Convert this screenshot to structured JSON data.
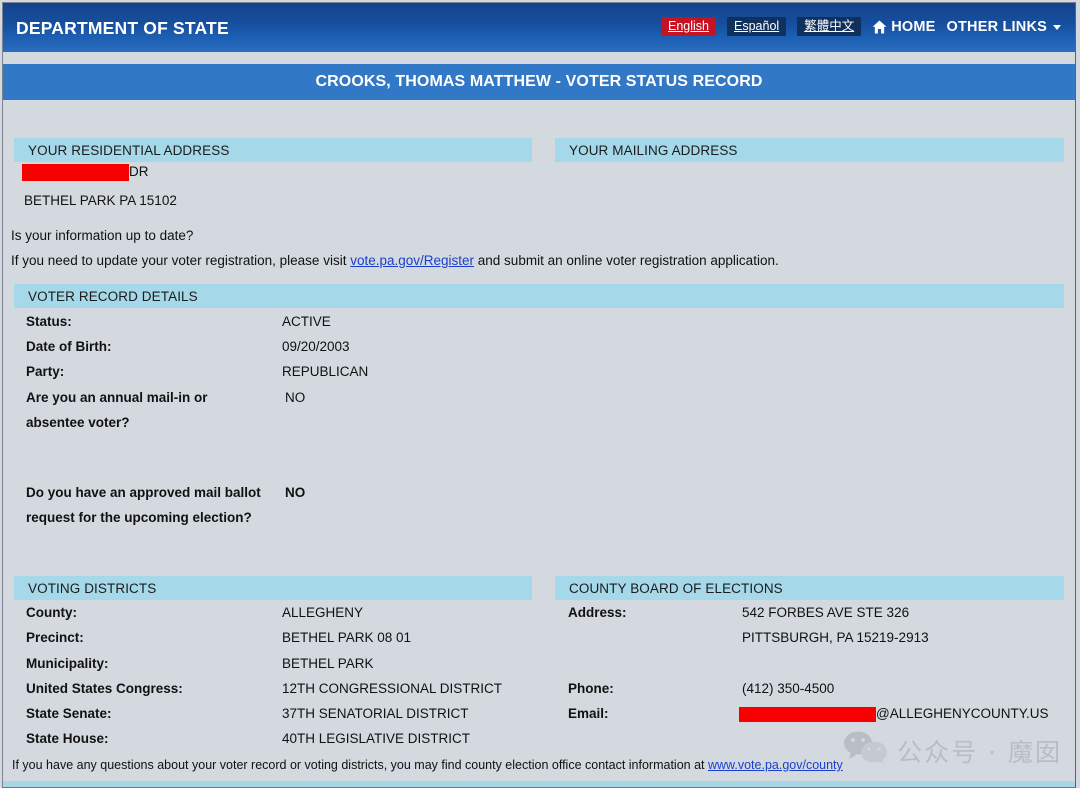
{
  "header": {
    "department_title": "DEPARTMENT OF STATE",
    "languages": [
      {
        "label": "English",
        "active": true
      },
      {
        "label": "Español",
        "active": false
      },
      {
        "label": "繁體中文",
        "active": false
      }
    ],
    "home_label": "HOME",
    "home_icon": "home-icon",
    "other_links_label": "OTHER LINKS",
    "other_links_icon": "chevron-down-icon",
    "colors": {
      "header_blue": "#17509f",
      "title_bar_blue": "#3178c6",
      "section_bar_blue": "#a5d8e8",
      "body_gray": "#d4d9e0",
      "active_lang_red": "#c41322",
      "link_blue": "#1a3fcc",
      "redaction_red": "#f60000"
    }
  },
  "record_title": "CROOKS, THOMAS MATTHEW - VOTER STATUS RECORD",
  "residential_address": {
    "section_title": "YOUR RESIDENTIAL ADDRESS",
    "line1_redacted": true,
    "line1_suffix": "DR",
    "line2": "BETHEL PARK PA 15102"
  },
  "mailing_address": {
    "section_title": "YOUR MAILING ADDRESS"
  },
  "update_prompt": {
    "question": "Is your information up to date?",
    "sentence_before_link": "If you need to update your voter registration, please visit ",
    "link_text": "vote.pa.gov/Register",
    "sentence_after_link": " and submit an online voter registration application."
  },
  "voter_record_details": {
    "section_title": "VOTER RECORD DETAILS",
    "fields": [
      {
        "label": "Status:",
        "value": "ACTIVE"
      },
      {
        "label": "Date of Birth:",
        "value": "09/20/2003"
      },
      {
        "label": "Party:",
        "value": "REPUBLICAN"
      },
      {
        "label_line1": "Are you an annual mail-in or",
        "label_line2": "absentee voter?",
        "value": "NO"
      },
      {
        "label_line1": "Do you have an approved mail ballot",
        "label_line2": "request for the upcoming election?",
        "value": "NO"
      }
    ]
  },
  "voting_districts": {
    "section_title": "VOTING DISTRICTS",
    "rows": [
      {
        "label": "County:",
        "value": "ALLEGHENY"
      },
      {
        "label": "Precinct:",
        "value": "BETHEL PARK 08 01"
      },
      {
        "label": "Municipality:",
        "value": "BETHEL PARK"
      },
      {
        "label": "United States Congress:",
        "value": "12TH CONGRESSIONAL DISTRICT"
      },
      {
        "label": "State Senate:",
        "value": "37TH SENATORIAL DISTRICT"
      },
      {
        "label": "State House:",
        "value": "40TH LEGISLATIVE DISTRICT"
      }
    ]
  },
  "county_board": {
    "section_title": "COUNTY BOARD OF ELECTIONS",
    "address_label": "Address:",
    "address_line1": "542 FORBES AVE STE 326",
    "address_line2": "PITTSBURGH, PA 15219-2913",
    "phone_label": "Phone:",
    "phone_value": "(412) 350-4500",
    "email_label": "Email:",
    "email_redacted": true,
    "email_domain": "@ALLEGHENYCOUNTY.US"
  },
  "footer": {
    "text_before_link": "If you have any questions about your voter record or voting districts, you may find county election office contact information at ",
    "link_text": "www.vote.pa.gov/county"
  },
  "watermark": {
    "text": "公众号：魔都囡",
    "badge_text": "公众号 · 魔囡",
    "badge_icon": "wechat-icon"
  }
}
